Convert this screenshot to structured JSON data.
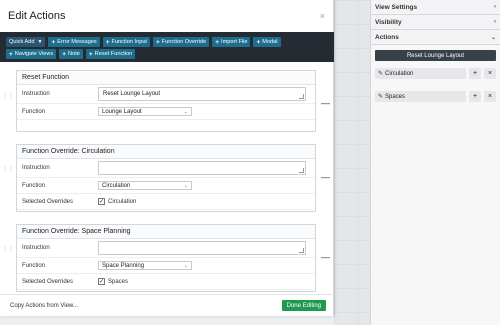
{
  "modal": {
    "title": "Edit Actions",
    "close_symbol": "×"
  },
  "toolbar": {
    "quick_add": "Quick Add",
    "buttons": [
      "Error Messages",
      "Function Input",
      "Function Override",
      "Import File",
      "Modal",
      "Navigate Views",
      "Note",
      "Reset Function"
    ]
  },
  "cards": [
    {
      "title": "Reset Function",
      "instruction_label": "Instruction",
      "instruction_value": "Reset Lounge Layout",
      "function_label": "Function",
      "function_value": "Lounge Layout"
    },
    {
      "title": "Function Override: Circulation",
      "instruction_label": "Instruction",
      "instruction_value": "",
      "function_label": "Function",
      "function_value": "Circulation",
      "overrides_label": "Selected Overrides",
      "override_value": "Circulation"
    },
    {
      "title": "Function Override: Space Planning",
      "instruction_label": "Instruction",
      "instruction_value": "",
      "function_label": "Function",
      "function_value": "Space Planning",
      "overrides_label": "Selected Overrides",
      "override_value": "Spaces"
    }
  ],
  "footer": {
    "copy_link": "Copy Actions from View...",
    "done": "Done Editing"
  },
  "right_panel": {
    "sections": [
      "View Settings",
      "Visibility",
      "Actions"
    ],
    "reset_button": "Reset Lounge Layout",
    "items": [
      "Circulation",
      "Spaces"
    ]
  },
  "colors": {
    "toolbar_bg": "#252b33",
    "toolbar_button": "#1f6d8c",
    "done_button": "#1e9950",
    "reset_button": "#38404a"
  }
}
